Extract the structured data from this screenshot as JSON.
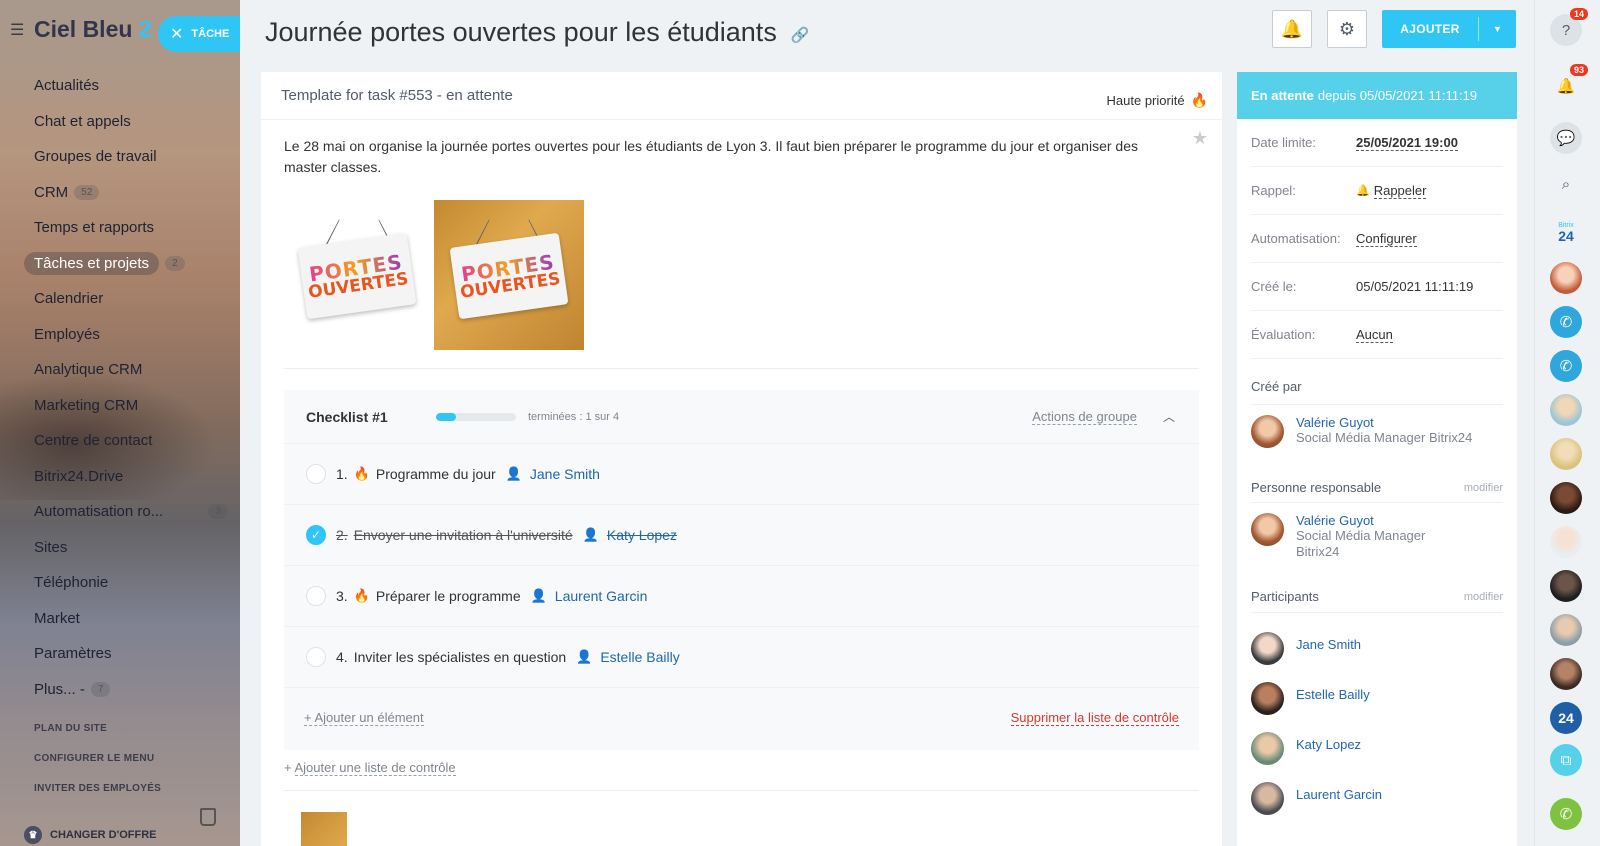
{
  "sidebar": {
    "brand": "Ciel Bleu",
    "brand_suffix": "2",
    "tache_button": "TÂCHE",
    "items": [
      {
        "label": "Actualités"
      },
      {
        "label": "Chat et appels"
      },
      {
        "label": "Groupes de travail"
      },
      {
        "label": "CRM",
        "count": "52"
      },
      {
        "label": "Temps et rapports"
      },
      {
        "label": "Tâches et projets",
        "count": "2",
        "active": true
      },
      {
        "label": "Calendrier"
      },
      {
        "label": "Employés"
      },
      {
        "label": "Analytique CRM"
      },
      {
        "label": "Marketing CRM"
      },
      {
        "label": "Centre de contact"
      },
      {
        "label": "Bitrix24.Drive"
      },
      {
        "label": "Automatisation ro...",
        "count": "3"
      },
      {
        "label": "Sites"
      },
      {
        "label": "Téléphonie"
      },
      {
        "label": "Market"
      },
      {
        "label": "Paramètres"
      },
      {
        "label": "Plus... -",
        "count": "7"
      }
    ],
    "links": [
      "PLAN DU SITE",
      "CONFIGURER LE MENU",
      "INVITER DES EMPLOYÉS"
    ],
    "change_offer": "CHANGER D'OFFRE"
  },
  "header": {
    "title": "Journée portes ouvertes pour les étudiants",
    "add_button": "AJOUTER"
  },
  "task": {
    "subtitle": "Template for task #553 - en attente",
    "priority": "Haute priorité",
    "description": "Le 28 mai on organise la journée portes ouvertes pour les étudiants de Lyon 3. Il faut bien préparer le programme du jour et organiser des master classes.",
    "image_text_1": "PORTES",
    "image_text_2": "OUVERTES"
  },
  "checklist": {
    "title": "Checklist #1",
    "progress": 0.25,
    "done_text": "terminées : 1 sur 4",
    "group_actions": "Actions de groupe",
    "items": [
      {
        "num": "1.",
        "text": "Programme du jour",
        "assignee": "Jane Smith",
        "done": false,
        "important": true
      },
      {
        "num": "2.",
        "text": "Envoyer une invitation à l'université",
        "assignee": "Katy Lopez",
        "done": true,
        "important": false
      },
      {
        "num": "3.",
        "text": "Préparer le programme",
        "assignee": "Laurent Garcin",
        "done": false,
        "important": true
      },
      {
        "num": "4.",
        "text": "Inviter les spécialistes en question",
        "assignee": "Estelle Bailly",
        "done": false,
        "important": false
      }
    ],
    "add_item": "Ajouter un élément",
    "delete_list": "Supprimer la liste de contrôle",
    "add_list": "Ajouter une liste de contrôle"
  },
  "panel": {
    "status_bold": "En attente",
    "status_rest": "depuis 05/05/2021 11:11:19",
    "rows": [
      {
        "label": "Date limite:",
        "value": "25/05/2021 19:00"
      },
      {
        "label": "Rappel:",
        "value": "Rappeler"
      },
      {
        "label": "Automatisation:",
        "value": "Configurer"
      },
      {
        "label": "Créé le:",
        "value": "05/05/2021 11:11:19"
      },
      {
        "label": "Évaluation:",
        "value": "Aucun"
      }
    ],
    "created_by_label": "Créé par",
    "creator": {
      "name": "Valérie Guyot",
      "role": "Social Média Manager Bitrix24"
    },
    "responsible_label": "Personne responsable",
    "modify": "modifier",
    "responsible": {
      "name": "Valérie Guyot",
      "role_line1": "Social Média Manager",
      "role_line2": "Bitrix24"
    },
    "participants_label": "Participants",
    "participants": [
      "Jane Smith",
      "Estelle Bailly",
      "Katy Lopez",
      "Laurent Garcin"
    ]
  },
  "rail": {
    "help_badge": "14",
    "notif_badge": "93",
    "bitrix_small": "Bitrix",
    "bitrix_big": "24",
    "b24_avatar": "24"
  },
  "colors": {
    "accent": "#2fc6f6",
    "status_bar": "#56d1e9",
    "link": "#2067b0",
    "danger": "#d9372c",
    "flame": "#f39c2c"
  }
}
